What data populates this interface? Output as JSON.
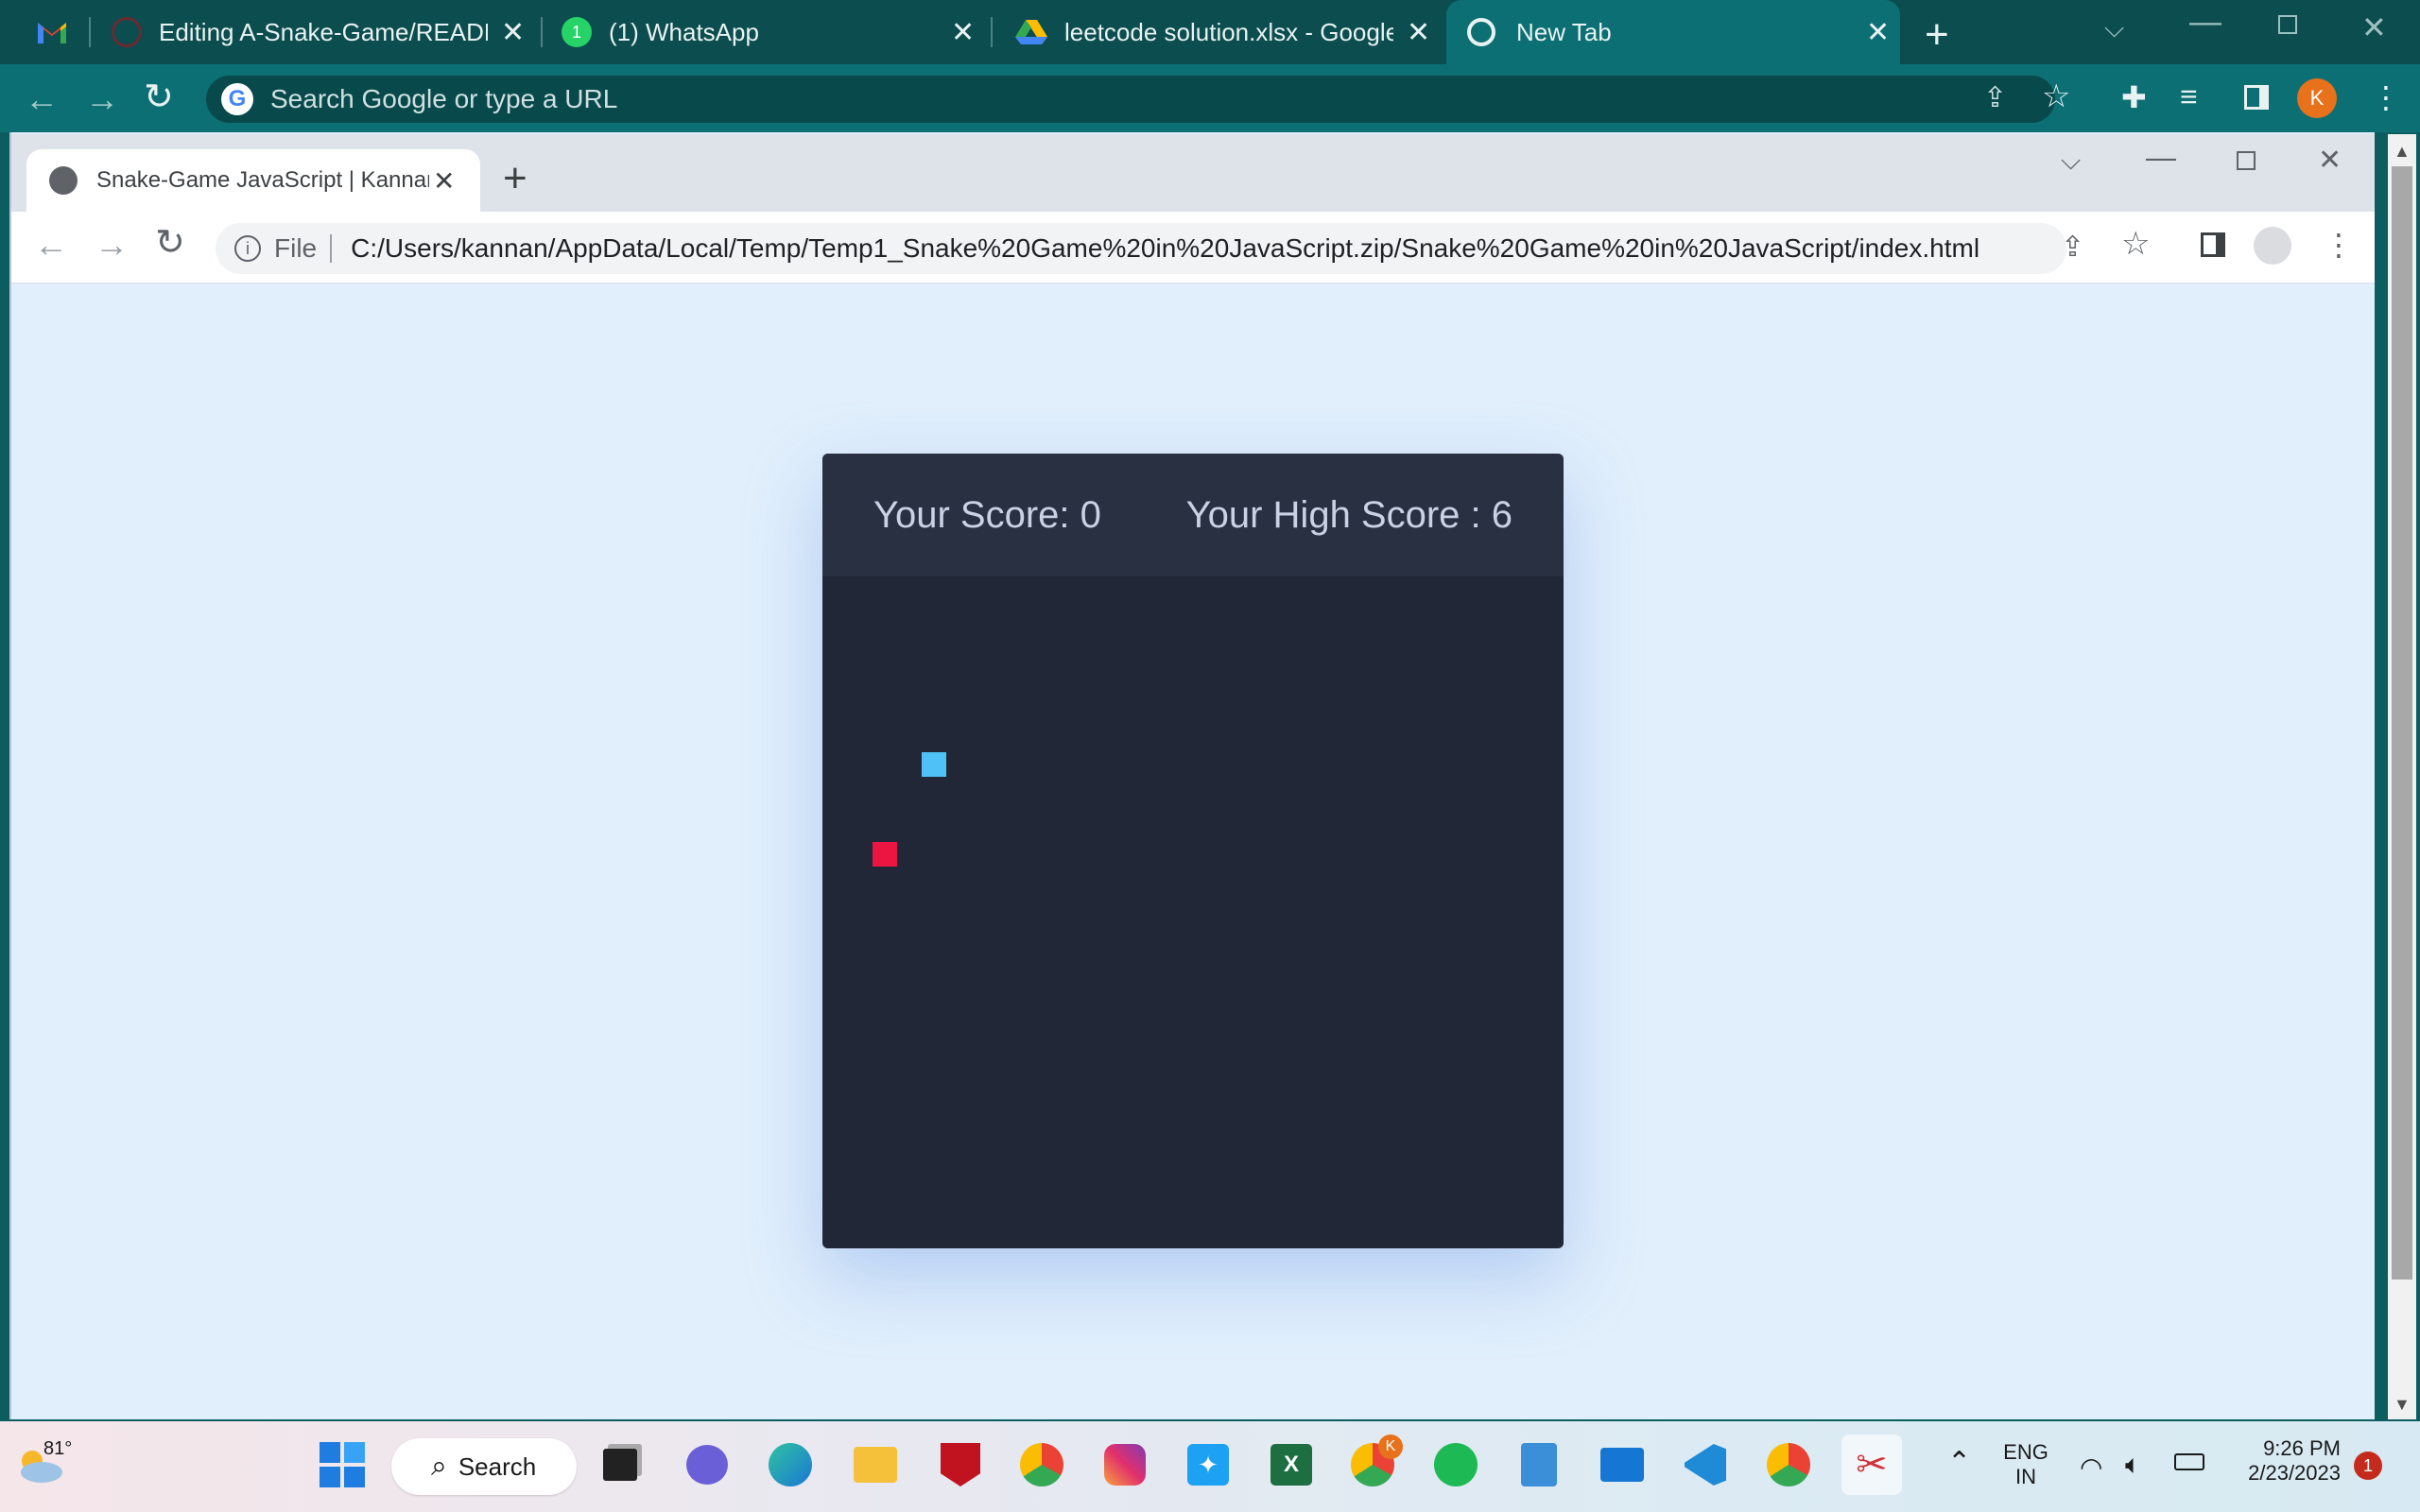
{
  "outer_browser": {
    "tabs": [
      {
        "label": "Editing A-Snake-Game/README."
      },
      {
        "label": "(1) WhatsApp"
      },
      {
        "label": "leetcode solution.xlsx - Google D"
      },
      {
        "label": "New Tab"
      }
    ],
    "omnibox_placeholder": "Search Google or type a URL",
    "profile_initial": "K"
  },
  "inner_browser": {
    "tab_label": "Snake-Game JavaScript | KannanI",
    "scheme_label": "File",
    "url": "C:/Users/kannan/AppData/Local/Temp/Temp1_Snake%20Game%20in%20JavaScript.zip/Snake%20Game%20in%20JavaScript/index.html"
  },
  "game": {
    "score_label": "Your Score: 0",
    "high_score_label": "Your High Score : 6",
    "snake_color": "#4fc1f6",
    "food_color": "#ec1542",
    "board_color": "#222738"
  },
  "taskbar": {
    "weather_temp": "81°",
    "search_label": "Search",
    "language": "ENG",
    "region": "IN",
    "time": "9:26 PM",
    "date": "2/23/2023",
    "notification_count": "1",
    "chrome_badge": "K"
  }
}
